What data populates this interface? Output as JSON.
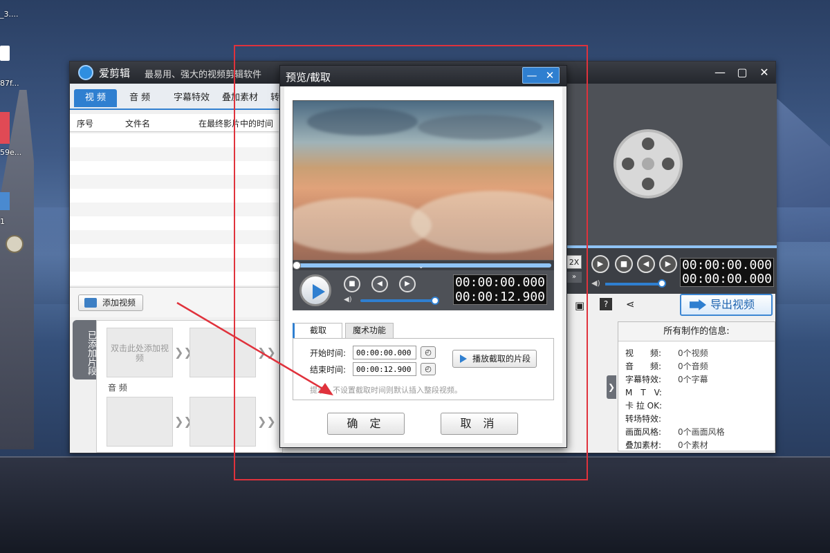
{
  "desktop": {
    "icons": [
      {
        "label": "_3...."
      },
      {
        "label": "87f..."
      },
      {
        "label": "59e..."
      },
      {
        "label": "1"
      }
    ]
  },
  "main_window": {
    "app_name": "爱剪辑",
    "slogan": "最易用、强大的视频剪辑软件",
    "tabs": [
      {
        "label": "视 频",
        "active": true
      },
      {
        "label": "音 频"
      },
      {
        "label": "字幕特效"
      },
      {
        "label": "叠加素材"
      },
      {
        "label": "转"
      }
    ],
    "table_headers": [
      "序号",
      "文件名",
      "在最终影片中的时间"
    ],
    "add_video_button": "添加视频",
    "added_clips_tab": "已添加片段",
    "timeline": {
      "placeholder": "双击此处添加视频",
      "audio_label": "音 频"
    },
    "speed_label": "2X",
    "time_current": "00:00:00.000",
    "time_total": "00:00:00.000",
    "export_button": "导出视频",
    "info_panel": {
      "title": "所有制作的信息:",
      "rows": [
        {
          "label": "视　　频:",
          "value": "0个视频"
        },
        {
          "label": "音　　频:",
          "value": "0个音频"
        },
        {
          "label": "字幕特效:",
          "value": "0个字幕"
        },
        {
          "label": "M　T　V:",
          "value": ""
        },
        {
          "label": "卡 拉 OK:",
          "value": ""
        },
        {
          "label": "转场特效:",
          "value": ""
        },
        {
          "label": "画面风格:",
          "value": "0个画面风格"
        },
        {
          "label": "叠加素材:",
          "value": "0个素材"
        }
      ]
    }
  },
  "dialog": {
    "title": "预览/截取",
    "time_current": "00:00:00.000",
    "time_total": "00:00:12.900",
    "tabs": [
      {
        "label": "截取",
        "active": true
      },
      {
        "label": "魔术功能"
      }
    ],
    "start_label": "开始时间:",
    "start_value": "00:00:00.000",
    "end_label": "结束时间:",
    "end_value": "00:00:12.900",
    "play_clip_button": "播放截取的片段",
    "hint": "提示：不设置截取时间则默认插入整段视频。",
    "ok_button": "确 定",
    "cancel_button": "取 消"
  },
  "colors": {
    "accent": "#2f7fd0",
    "annotation_red": "#e0323c"
  }
}
